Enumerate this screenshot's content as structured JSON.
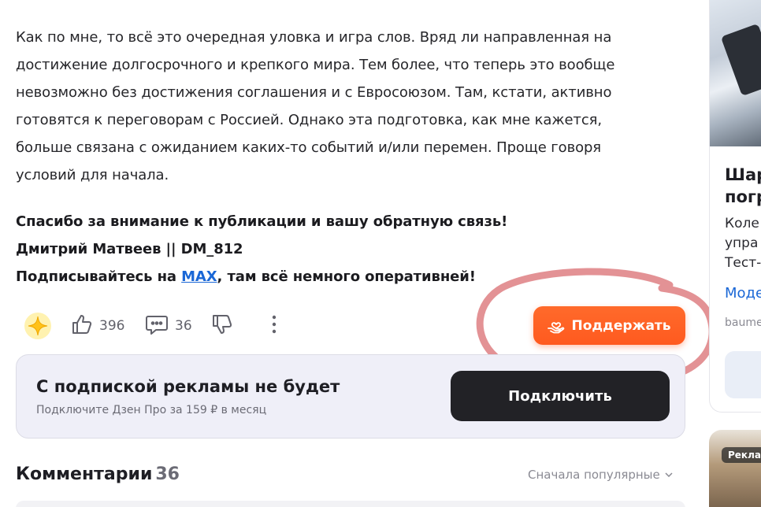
{
  "article": {
    "paragraph1": [
      "Как по мне, то всё это очередная уловка и игра слов. Вряд ли направленная на",
      "достижение долгосрочного и крепкого мира. Тем более, что теперь это вообще",
      "невозможно без достижения соглашения и с Евросоюзом. Там, кстати, активно",
      "готовятся к переговорам с Россией. Однако эта подготовка, как мне кажется,",
      "больше связана с ожиданием каких-то событий и/или перемен. Проще говоря",
      "условий для начала."
    ],
    "thanks": "Спасибо за внимание к публикации и вашу обратную связь!",
    "author": "Дмитрий Матвеев || DM_812",
    "subscribe_prefix": "Подписывайтесь на ",
    "subscribe_link": "MAX",
    "subscribe_suffix": ", там всё немного оперативней!"
  },
  "actions": {
    "likes": "396",
    "comments": "36",
    "support_label": "Поддержать"
  },
  "promo": {
    "title": "С подпиской рекламы не будет",
    "subtitle": "Подключите Дзен Про за 159 ₽ в месяц",
    "button_label": "Подключить"
  },
  "comments": {
    "heading": "Комментарии",
    "count": "36",
    "sort_label": "Сначала популярные"
  },
  "sidebar": {
    "card_title_line1": "Шар",
    "card_title_line2": "погр",
    "card_text_line1": "Коле",
    "card_text_line2": "упра",
    "card_text_line3": "Тест-",
    "card_link": "Моде",
    "card_domain": "baume",
    "ad_badge": "Реклам"
  },
  "colors": {
    "accent_orange": "#ff5a1f",
    "link_blue": "#1a67d6",
    "annotation_circle": "#e0868a"
  }
}
